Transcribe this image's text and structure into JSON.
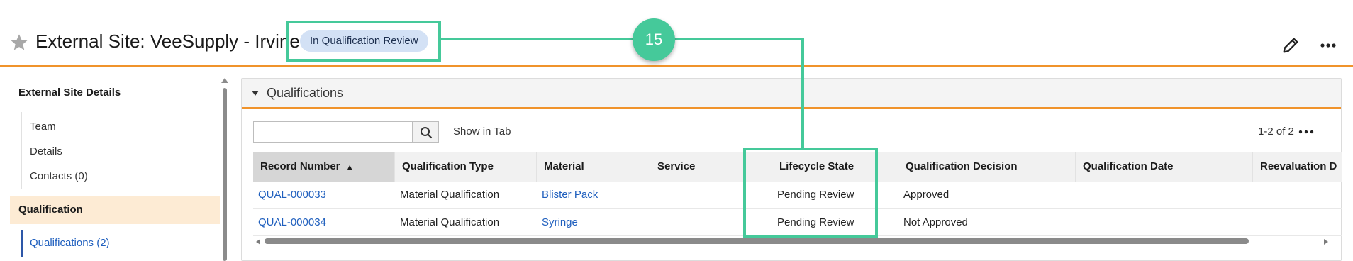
{
  "header": {
    "title": "External Site: VeeSupply - Irvine",
    "state_badge": "In Qualification Review",
    "star_icon": "star-icon",
    "edit_icon": "pencil-icon",
    "more_icon": "more-horizontal-icon"
  },
  "sidebar": {
    "section_title": "External Site Details",
    "items": [
      {
        "label": "Team"
      },
      {
        "label": "Details"
      },
      {
        "label": "Contacts (0)"
      }
    ],
    "active_section": "Qualification",
    "active_item": "Qualifications (2)"
  },
  "panel": {
    "title": "Qualifications",
    "search": {
      "placeholder": "",
      "value": ""
    },
    "show_in_tab": "Show in Tab",
    "count": "1-2 of 2",
    "columns": [
      "Record Number",
      "Qualification Type",
      "Material",
      "Service",
      "Lifecycle State",
      "Qualification Decision",
      "Qualification Date",
      "Reevaluation D"
    ],
    "sort_indicator": "▲",
    "rows": [
      {
        "record_number": "QUAL-000033",
        "qualification_type": "Material Qualification",
        "material": "Blister Pack",
        "service": "",
        "lifecycle_state": "Pending Review",
        "qualification_decision": "Approved",
        "qualification_date": "",
        "reevaluation_date": ""
      },
      {
        "record_number": "QUAL-000034",
        "qualification_type": "Material Qualification",
        "material": "Syringe",
        "service": "",
        "lifecycle_state": "Pending Review",
        "qualification_decision": "Not Approved",
        "qualification_date": "",
        "reevaluation_date": ""
      }
    ]
  },
  "callout": {
    "number": "15",
    "color": "#45c99a"
  },
  "colors": {
    "accent_orange": "#f0932b",
    "link_blue": "#1f5fbe",
    "badge_bg": "#d3e1f5",
    "active_section_bg": "#fdebd4"
  }
}
